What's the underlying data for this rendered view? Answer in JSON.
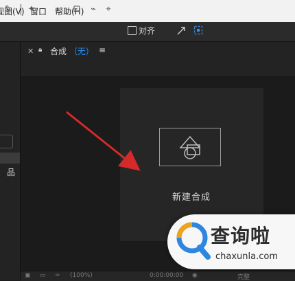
{
  "menu": {
    "view": "视图(V)",
    "window": "窗口",
    "help": "帮助(H)"
  },
  "toolbar": {
    "align_label": "对齐"
  },
  "comp_panel": {
    "tab_title": "合成",
    "tab_state": "（无）"
  },
  "viewer": {
    "new_comp_label": "新建合成"
  },
  "bottom_bar": {
    "zoom": "(100%)",
    "timecode": "0:00:00:00",
    "quality": "完整"
  },
  "watermark": {
    "text": "查询啦",
    "url": "chaxunla.com"
  },
  "colors": {
    "accent": "#2d8ceb",
    "arrow": "#d42a2a"
  }
}
